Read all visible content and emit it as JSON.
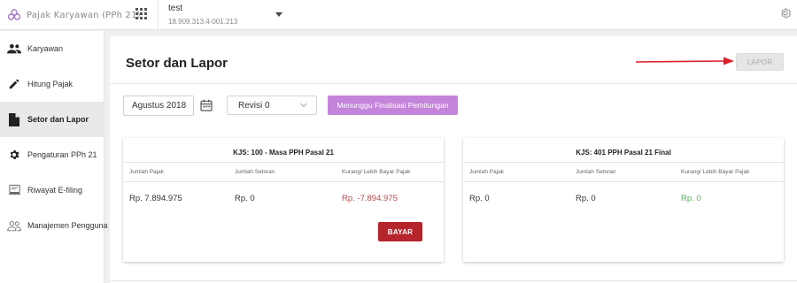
{
  "header": {
    "app_name": "Pajak Karyawan (PPh 21)",
    "company_name": "test",
    "company_npwp": "18.909.313.4-001.213"
  },
  "sidebar": {
    "items": [
      {
        "label": "Karyawan",
        "icon": "people-icon"
      },
      {
        "label": "Hitung Pajak",
        "icon": "pencil-icon"
      },
      {
        "label": "Setor dan Lapor",
        "icon": "document-icon",
        "active": true
      },
      {
        "label": "Pengaturan PPh 21",
        "icon": "gear-icon"
      },
      {
        "label": "Riwayat E-filing",
        "icon": "computer-icon"
      },
      {
        "label": "Manajemen Pengguna",
        "icon": "users-icon"
      }
    ]
  },
  "main": {
    "title": "Setor dan Lapor",
    "lapor_label": "LAPOR",
    "period": "Agustus 2018",
    "revisi": "Revisi 0",
    "status_label": "Menunggu Finalisasi Perhitungan",
    "cards": [
      {
        "title": "KJS: 100 - Masa PPH Pasal 21",
        "headers": [
          "Jumlah Pajak",
          "Jumlah Setoran",
          "Kurang/ Lebih Bayar Pajak"
        ],
        "values": [
          "Rp. 7.894.975",
          "Rp. 0",
          "Rp. -7.894.975"
        ],
        "button_label": "BAYAR"
      },
      {
        "title": "KJS: 401 PPH Pasal 21 Final",
        "headers": [
          "Jumlah Pajak",
          "Jumlah Setoran",
          "Kurang/ Lebih Bayar Pajak"
        ],
        "values": [
          "Rp. 0",
          "Rp. 0",
          "Rp. 0"
        ]
      }
    ]
  },
  "colors": {
    "accent_purple": "#c484da",
    "danger_red": "#b5252b",
    "negative_text": "#b54a4a",
    "positive_text": "#5ab05a"
  }
}
